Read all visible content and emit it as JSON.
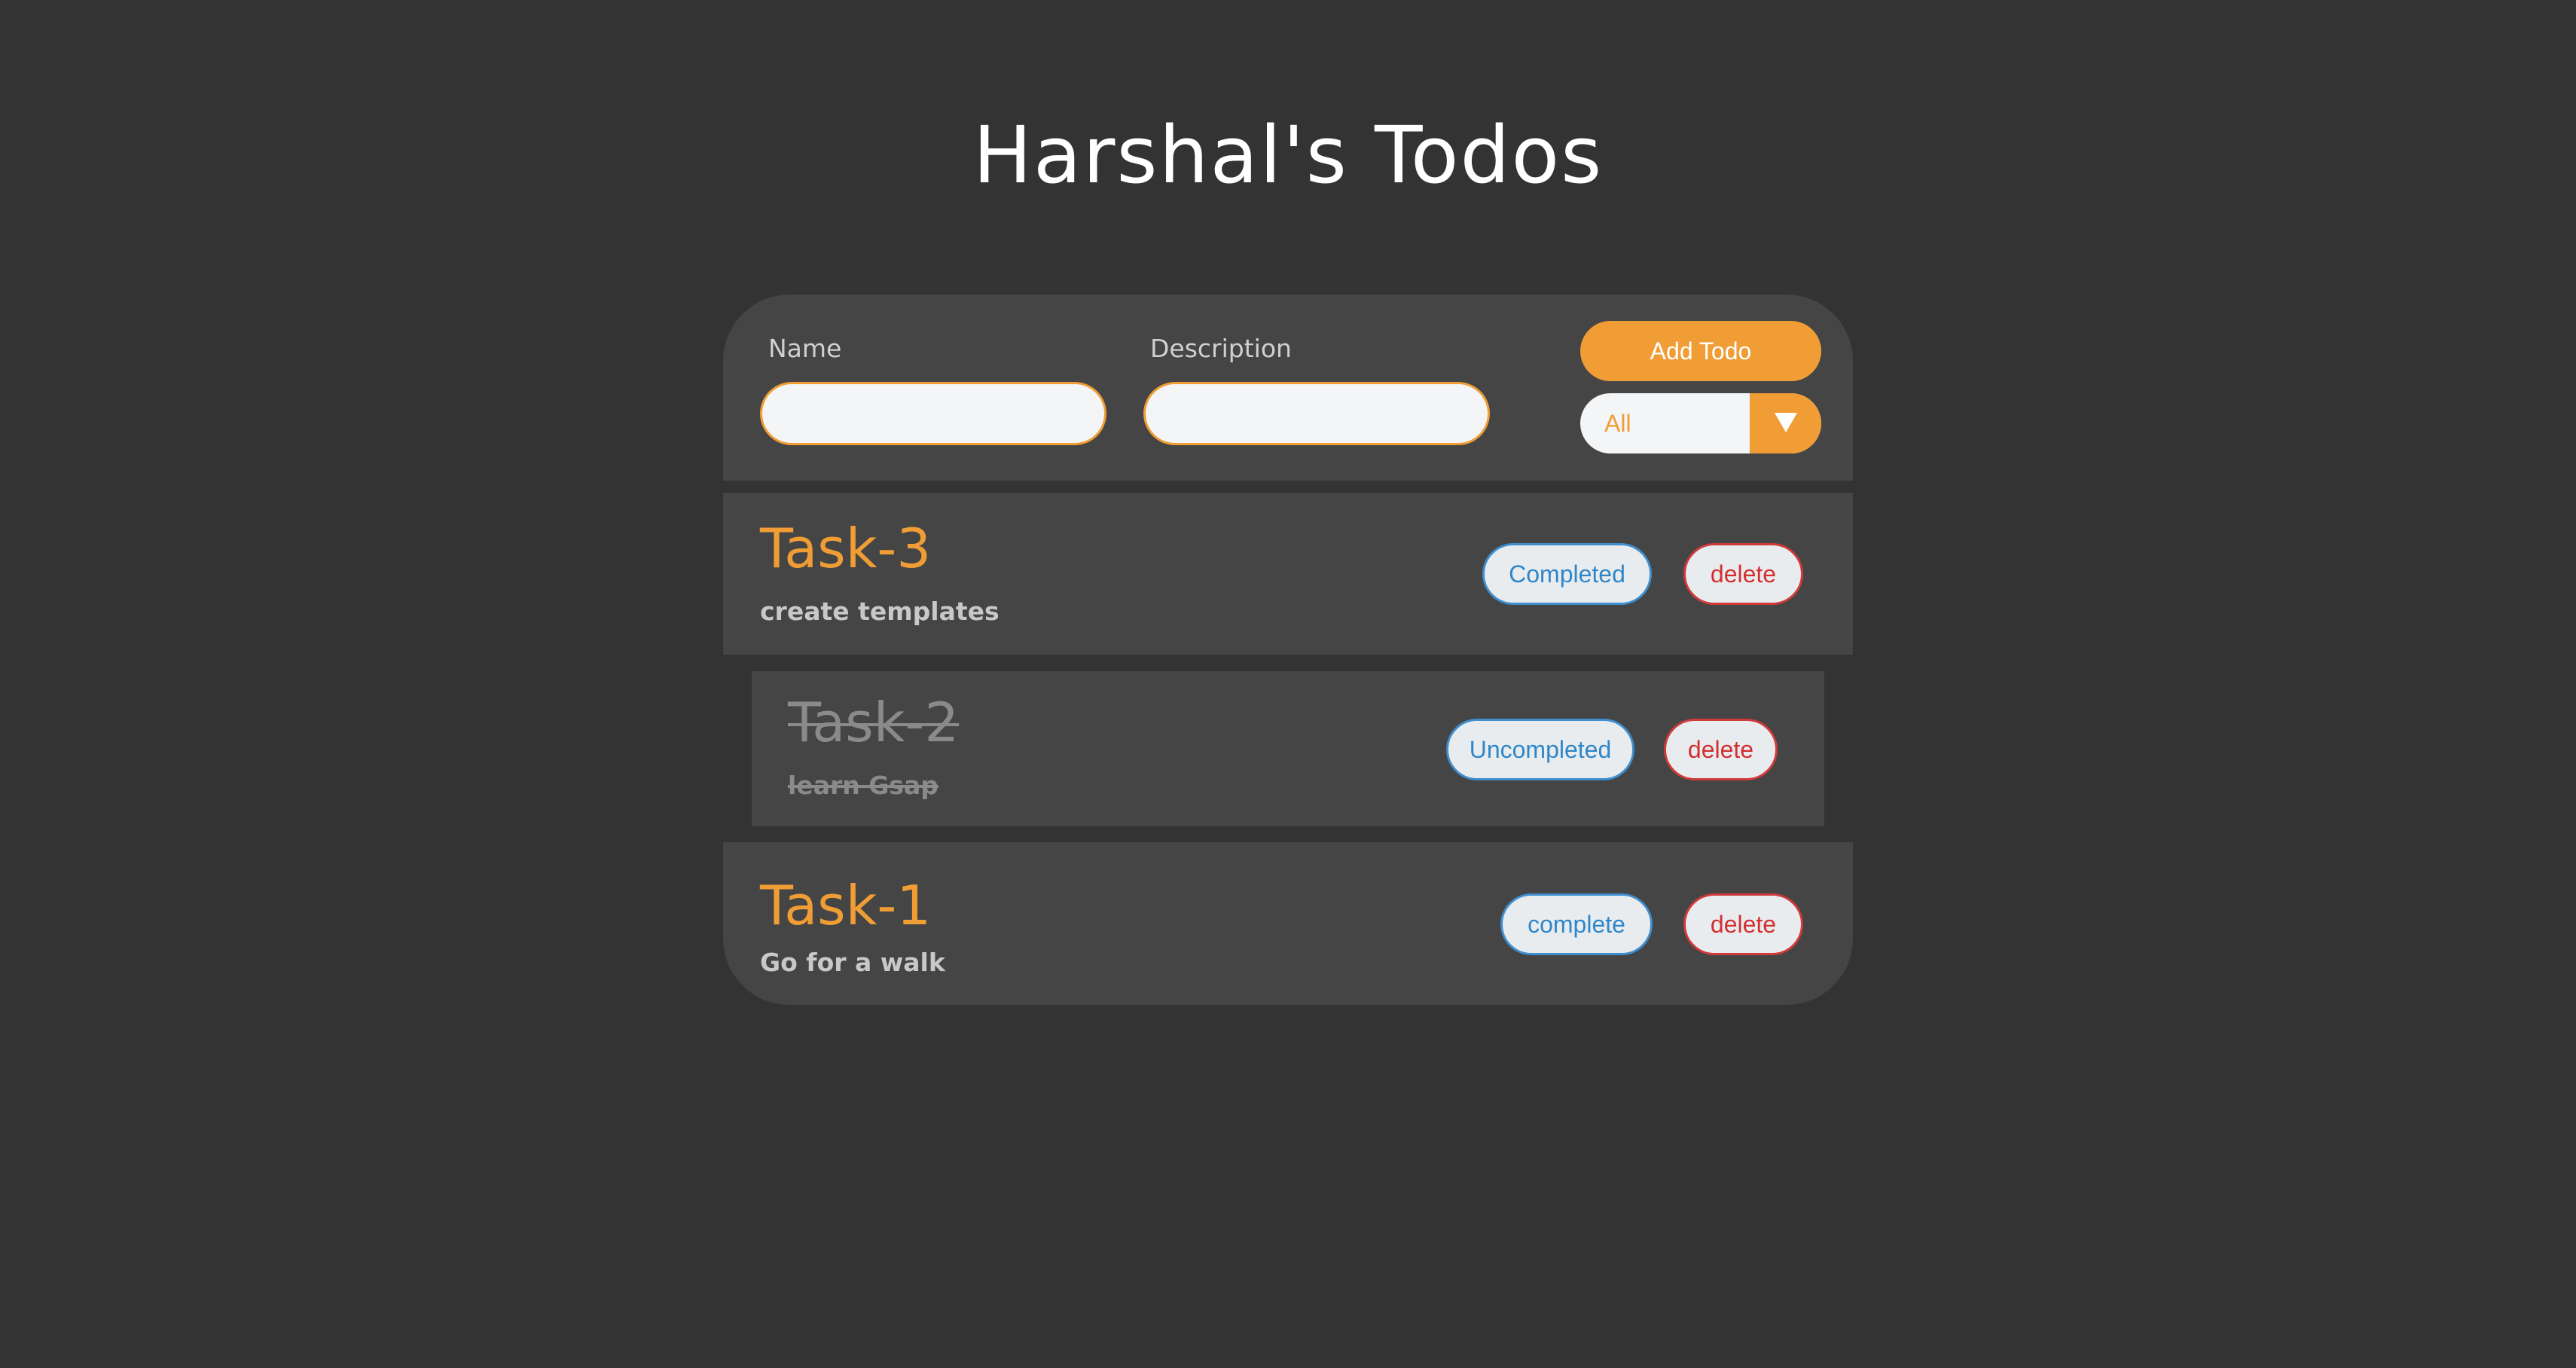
{
  "page": {
    "title": "Harshal's Todos"
  },
  "form": {
    "name_label": "Name",
    "name_value": "",
    "description_label": "Description",
    "description_value": "",
    "add_button_label": "Add Todo",
    "filter_selected": "All",
    "filter_arrow_icon": "triangle-down-icon"
  },
  "todos": [
    {
      "name": "Task-3",
      "description": "create templates",
      "status_label": "Completed",
      "delete_label": "delete",
      "completed": false
    },
    {
      "name": "Task-2",
      "description": "learn Gsap",
      "status_label": "Uncompleted",
      "delete_label": "delete",
      "completed": true
    },
    {
      "name": "Task-1",
      "description": "Go for a walk",
      "status_label": "complete",
      "delete_label": "delete",
      "completed": false
    }
  ],
  "colors": {
    "background": "#333333",
    "panel": "#454545",
    "accent": "#f09d35",
    "status_blue": "#2f87c9",
    "delete_red": "#d32f2f"
  }
}
